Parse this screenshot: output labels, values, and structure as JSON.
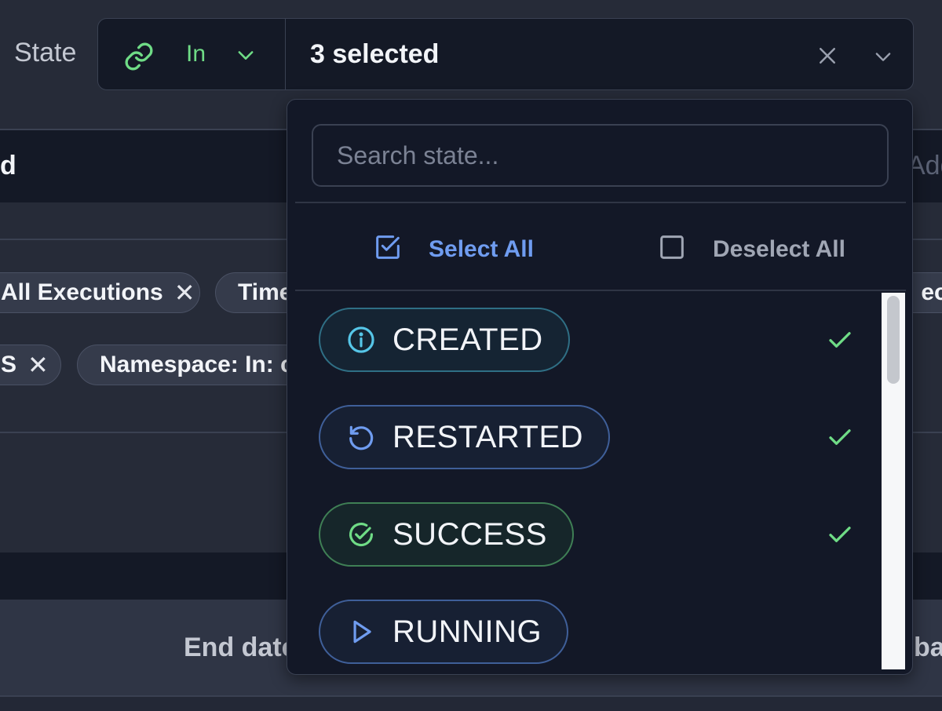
{
  "filter": {
    "label": "State",
    "operator": "In",
    "selected_summary": "3 selected"
  },
  "background": {
    "band_text": "d",
    "add_text": "Add",
    "chips_row1": [
      {
        "label": "All Executions",
        "removable": true
      },
      {
        "label": "Time",
        "removable": false
      },
      {
        "label": ": ec",
        "removable": false
      }
    ],
    "chips_row2": [
      {
        "label": "S",
        "removable": true
      },
      {
        "label": "Namespace: In: c",
        "removable": false
      }
    ],
    "end_date": "End date",
    "right_text": "bac"
  },
  "dropdown": {
    "search_placeholder": "Search state...",
    "select_all": "Select All",
    "deselect_all": "Deselect All",
    "options": [
      {
        "label": "CREATED",
        "icon": "info-circle-icon",
        "color": "#56c6e8",
        "border": "#2f6f85",
        "selected": true
      },
      {
        "label": "RESTARTED",
        "icon": "restart-icon",
        "color": "#6f9cf0",
        "border": "#3f5f99",
        "selected": true
      },
      {
        "label": "SUCCESS",
        "icon": "check-circle-icon",
        "color": "#6fdc86",
        "border": "#3f7f55",
        "selected": true
      },
      {
        "label": "RUNNING",
        "icon": "play-icon",
        "color": "#6f9cf0",
        "border": "#3f5f99",
        "selected": false
      }
    ]
  },
  "colors": {
    "accent_green": "#6fdc86",
    "accent_blue": "#6f9cf0",
    "panel_bg": "#131827",
    "page_bg": "#262b38"
  }
}
